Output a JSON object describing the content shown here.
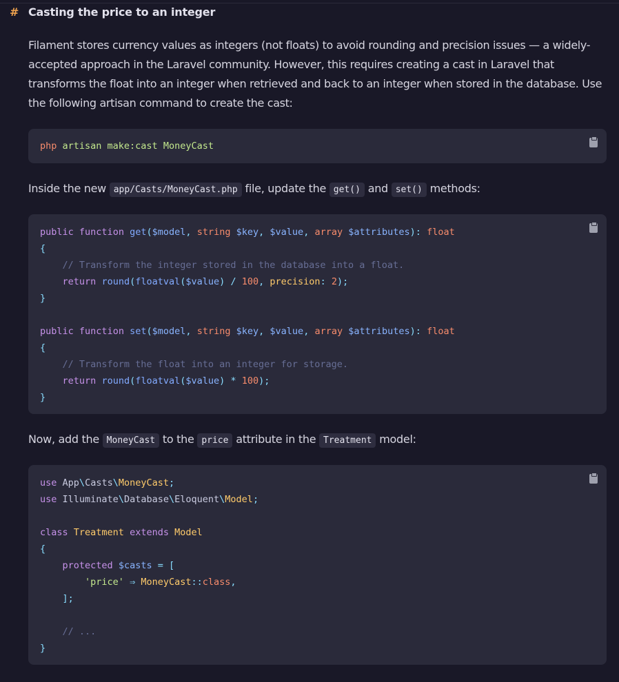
{
  "heading": {
    "hash": "#",
    "title": "Casting the price to an integer"
  },
  "intro": "Filament stores currency values as integers (not floats) to avoid rounding and precision issues — a widely-accepted approach in the Laravel community. However, this requires creating a cast in Laravel that transforms the float into an integer when retrieved and back to an integer when stored in the database. Use the following artisan command to create the cast:",
  "command": {
    "bin": "php",
    "rest": " artisan make:cast MoneyCast"
  },
  "para2": {
    "before": "Inside the new ",
    "file": "app/Casts/MoneyCast.php",
    "mid1": " file, update the ",
    "get": "get()",
    "mid2": " and ",
    "set": "set()",
    "after": " methods:"
  },
  "para3": {
    "before": "Now, add the ",
    "cast": "MoneyCast",
    "mid1": " to the ",
    "attr": "price",
    "mid2": " attribute in the ",
    "model": "Treatment",
    "after": " model:"
  },
  "code2_lines": [
    "public function get($model, string $key, $value, array $attributes): float",
    "{",
    "    // Transform the integer stored in the database into a float.",
    "    return round(floatval($value) / 100, precision: 2);",
    "}",
    "",
    "public function set($model, string $key, $value, array $attributes): float",
    "{",
    "    // Transform the float into an integer for storage.",
    "    return round(floatval($value) * 100);",
    "}"
  ],
  "code3_lines": [
    "use App\\Casts\\MoneyCast;",
    "use Illuminate\\Database\\Eloquent\\Model;",
    "",
    "class Treatment extends Model",
    "{",
    "    protected $casts = [",
    "        'price' ⇒ MoneyCast::class,",
    "    ];",
    "",
    "    // ...",
    "}"
  ],
  "icons": {
    "copy": "clipboard-icon"
  },
  "colors": {
    "background": "#191827",
    "code_bg": "#2a2a3a",
    "accent": "#f0a34e"
  }
}
